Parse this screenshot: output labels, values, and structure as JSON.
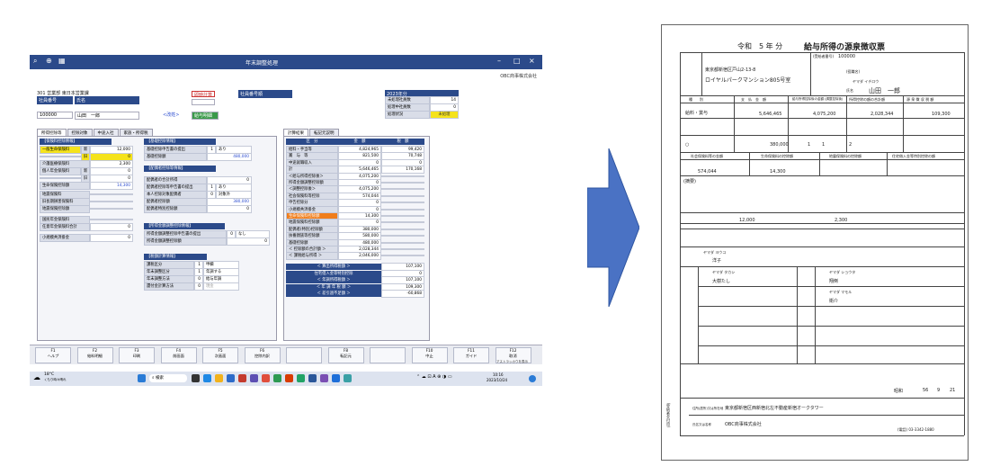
{
  "app": {
    "window_title": "年末調整処理",
    "company": "OBC商事株式会社",
    "dept_line": "301 営業部 東日本営業課",
    "emp_no_label": "社員番号",
    "name_label": "氏名",
    "emp_no": "100000",
    "emp_name": "山田　一郎",
    "kana_link": "<改姓>",
    "recalc_button": "即時計算",
    "salary_button": "給与明細",
    "emp_no_header": "社員番号順",
    "year_label": "2023年分",
    "counts": [
      {
        "label": "未処理社員数",
        "value": "14"
      },
      {
        "label": "処理中社員数",
        "value": "0"
      },
      {
        "label": "処理状況",
        "value": "未処理"
      }
    ],
    "tabs": [
      "所得控除等",
      "控除対象",
      "中途入社",
      "家族・所得税"
    ],
    "right_tabs": [
      "計算結果",
      "転記元説明"
    ],
    "insurance_header": "【保険料控除情報】",
    "insurance_rows": [
      {
        "label": "一般生命保険料",
        "sub": "新",
        "value": "12,000",
        "hl": true
      },
      {
        "label": "",
        "sub": "旧",
        "value": "0",
        "hl": true
      },
      {
        "label": "介護医療保険料",
        "sub": "",
        "value": "2,300"
      },
      {
        "label": "個人年金保険料",
        "sub": "新",
        "value": "0"
      },
      {
        "label": "",
        "sub": "旧",
        "value": "0"
      },
      {
        "label": "生命保険控除額",
        "sub": "",
        "value": "14,300",
        "blue": true
      },
      {
        "label": "地震保険料",
        "sub": "",
        "value": ""
      },
      {
        "label": "旧長期損害保険料",
        "sub": "",
        "value": ""
      },
      {
        "label": "地震保険控除額",
        "sub": "",
        "value": ""
      },
      {
        "label": "国民年金保険料",
        "sub": "",
        "value": ""
      },
      {
        "label": "任意年金保険料合計",
        "sub": "",
        "value": "0"
      },
      {
        "label": "小規模共済掛金",
        "sub": "",
        "value": "0"
      }
    ],
    "basic_header": "【基礎控除情報】",
    "basic_rows": [
      {
        "label": "基礎控除申告書の提出",
        "value": "1",
        "opt": "あり"
      },
      {
        "label": "基礎控除額",
        "value": "480,000"
      }
    ],
    "spouse_header": "【配偶者控除等情報】",
    "spouse_rows": [
      {
        "label": "配偶者の合計所得",
        "value": "0"
      },
      {
        "label": "配偶者控除等申告書の提出",
        "value": "1",
        "opt": "あり"
      },
      {
        "label": "本人控除対象配偶者",
        "value": "0",
        "opt": "対象外"
      },
      {
        "label": "配偶者控除額",
        "value": "380,000"
      },
      {
        "label": "配偶者特別控除額",
        "value": "0"
      }
    ],
    "adjust_header": "【所得金額調整控除情報】",
    "adjust_rows": [
      {
        "label": "所得金額調整控除申告書の提出",
        "value": "0",
        "opt": "なし"
      },
      {
        "label": "所得金額調整控除額",
        "value": "0"
      }
    ],
    "calc_header": "【税額計算情報】",
    "calc_rows": [
      {
        "label": "課税区分",
        "value": "1",
        "opt": "甲欄"
      },
      {
        "label": "年末調整区分",
        "value": "1",
        "opt": "年調する"
      },
      {
        "label": "年末調整方法",
        "value": "0",
        "opt": "給与年調"
      },
      {
        "label": "還付金計算方法",
        "value": "0",
        "opt": "現金"
      }
    ],
    "result_headers": [
      "区　分",
      "金　額",
      "税　額"
    ],
    "result_rows": [
      {
        "label": "給料・手当等",
        "amount": "4,824,965",
        "tax": "99,420"
      },
      {
        "label": "賞　与　等",
        "amount": "821,500",
        "tax": "70,748"
      },
      {
        "label": "中途就職収入",
        "amount": "0",
        "tax": "0"
      },
      {
        "label": "計",
        "amount": "5,646,465",
        "tax": "170,168"
      },
      {
        "label": "＜給与所得控除後＞",
        "amount": "4,075,200",
        "tax": ""
      },
      {
        "label": "所得金額調整控除額",
        "amount": "0",
        "tax": ""
      },
      {
        "label": "＜調整控除後＞",
        "amount": "4,075,200",
        "tax": ""
      },
      {
        "label": "社会保険料等控除",
        "amount": "574,044",
        "tax": ""
      },
      {
        "label": "申告控除分",
        "amount": "0",
        "tax": ""
      },
      {
        "label": "小規模共済掛金",
        "amount": "0",
        "tax": ""
      },
      {
        "label": "生命保険料控除額",
        "amount": "14,300",
        "tax": "",
        "orange": true
      },
      {
        "label": "地震保険料控除額",
        "amount": "0",
        "tax": ""
      },
      {
        "label": "配偶者(特別)控除額",
        "amount": "380,000",
        "tax": ""
      },
      {
        "label": "扶養親族等控除額",
        "amount": "580,000",
        "tax": ""
      },
      {
        "label": "基礎控除額",
        "amount": "480,000",
        "tax": ""
      },
      {
        "label": "＜ 控除額の合計額 ＞",
        "amount": "2,028,344",
        "tax": ""
      },
      {
        "label": "＜ 課税給与所得 ＞",
        "amount": "2,046,000",
        "tax": ""
      }
    ],
    "result_tail": [
      {
        "label": "＜ 算出所得税額 ＞",
        "value": "107,100"
      },
      {
        "label": "住宅借入金等特別控除",
        "value": "0"
      },
      {
        "label": "＜ 年調所得税額 ＞",
        "value": "107,100"
      },
      {
        "label": "＜ 年 調 年 税 額 ＞",
        "value": "109,300"
      },
      {
        "label": "＜ 差引過不足額 ＞",
        "value": "-60,868"
      }
    ],
    "fkeys": [
      {
        "key": "F1",
        "label": "ヘルプ"
      },
      {
        "key": "F2",
        "label": "給料明細"
      },
      {
        "key": "F3",
        "label": "印刷"
      },
      {
        "key": "F4",
        "label": "前画面"
      },
      {
        "key": "F5",
        "label": "次画面"
      },
      {
        "key": "F6",
        "label": "控除内訳"
      },
      {
        "key": "",
        "label": ""
      },
      {
        "key": "F8",
        "label": "転記元"
      },
      {
        "key": "",
        "label": ""
      },
      {
        "key": "F10",
        "label": "中止"
      },
      {
        "key": "F11",
        "label": "ガイド"
      },
      {
        "key": "F12",
        "label": "取消"
      }
    ],
    "fkey_note": "アストラッカウを表示",
    "weather": "18°C",
    "weather_sub": "くもり時々晴れ",
    "search": "検索",
    "clock_time": "10:16",
    "clock_date": "2023/10/24"
  },
  "doc": {
    "title_year": "令和　5 年 分",
    "title": "給与所得の源泉徴収票",
    "receiver_no_label": "(受給者番号)",
    "receiver_no": "100000",
    "address1": "東京都新宿区戸山2-13-8",
    "address2": "ロイヤルパークマンション805号室",
    "role_label": "(役職名)",
    "kana": "ヤマダ イチロウ",
    "name_label": "氏名",
    "name": "山田　一郎",
    "col_heads": [
      "種　　別",
      "支　払　金　額",
      "給与所得控除後の金額\n(調整控除後)",
      "所得控除の額の合計額",
      "源 泉 徴 収 税 額"
    ],
    "kind": "給料・賞与",
    "pay": "5,646,465",
    "after_ded": "4,075,200",
    "ded_total": "2,028,344",
    "tax": "109,300",
    "spouse_mark": "○",
    "spouse_ded": "380,000",
    "dep1": "1",
    "dep2": "1",
    "dep3": "2",
    "ins_heads": [
      "社会保険料等の金額",
      "生命保険料の控除額",
      "地震保険料の控除額",
      "住宅借入金等特別控除の額"
    ],
    "social": "574,044",
    "life": "14,300",
    "memo_label": "(摘要)",
    "new_life": "12,000",
    "care": "2,300",
    "spouse_kana": "ヤマダ ヨウコ",
    "spouse_name": "洋子",
    "deps_kana": [
      "ヤマダ タカシ",
      "ヤマダ ショウタ",
      "ヤマダ マモル"
    ],
    "deps_name": [
      "大樹たし",
      "翔倒",
      "衛介"
    ],
    "birth_era": "昭和",
    "birth": [
      "56",
      "9",
      "21"
    ],
    "payer_addr_label": "住所(居所)又は所在地",
    "payer_addr": "東京都新宿区西新宿北左不動産新宿オークタワー",
    "payer_name_label": "氏名又は名称",
    "payer_name": "OBC商事株式会社",
    "payer_tel": "(電話) 03-3342-1880",
    "side_label": "(受給者交付用)"
  }
}
